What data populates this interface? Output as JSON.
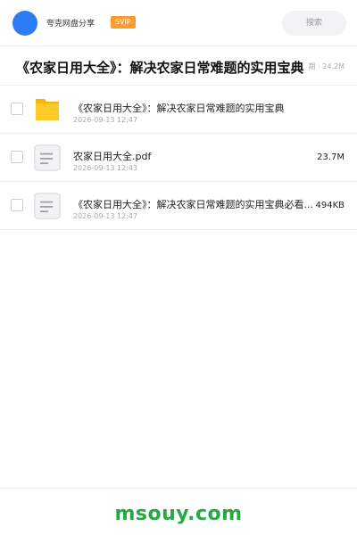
{
  "header": {
    "brand": "夸克网盘分享",
    "badge": "SVIP",
    "search_placeholder": "搜索"
  },
  "share": {
    "title": "《农家日用大全》：解决农家日常难题的实用宝典",
    "meta": "期 · 24.2M"
  },
  "files": [
    {
      "type": "folder",
      "icon": "folder-icon",
      "name": "《农家日用大全》：解决农家日常难题的实用宝典",
      "date": "2026-09-13 12:47",
      "size": ""
    },
    {
      "type": "file",
      "icon": "document-icon",
      "name": "农家日用大全.pdf",
      "date": "2026-09-13 12:43",
      "size": "23.7M"
    },
    {
      "type": "file",
      "icon": "document-icon",
      "name": "《农家日用大全》：解决农家日常难题的实用宝典必看...",
      "date": "2026-09-13 12:47",
      "size": "494KB"
    }
  ],
  "footer": {
    "site": "msouy.com"
  },
  "colors": {
    "avatar": "#2d7cf6",
    "badge": "#ff9a2e",
    "folder": "#ffc107",
    "footer_text": "#27a844"
  }
}
